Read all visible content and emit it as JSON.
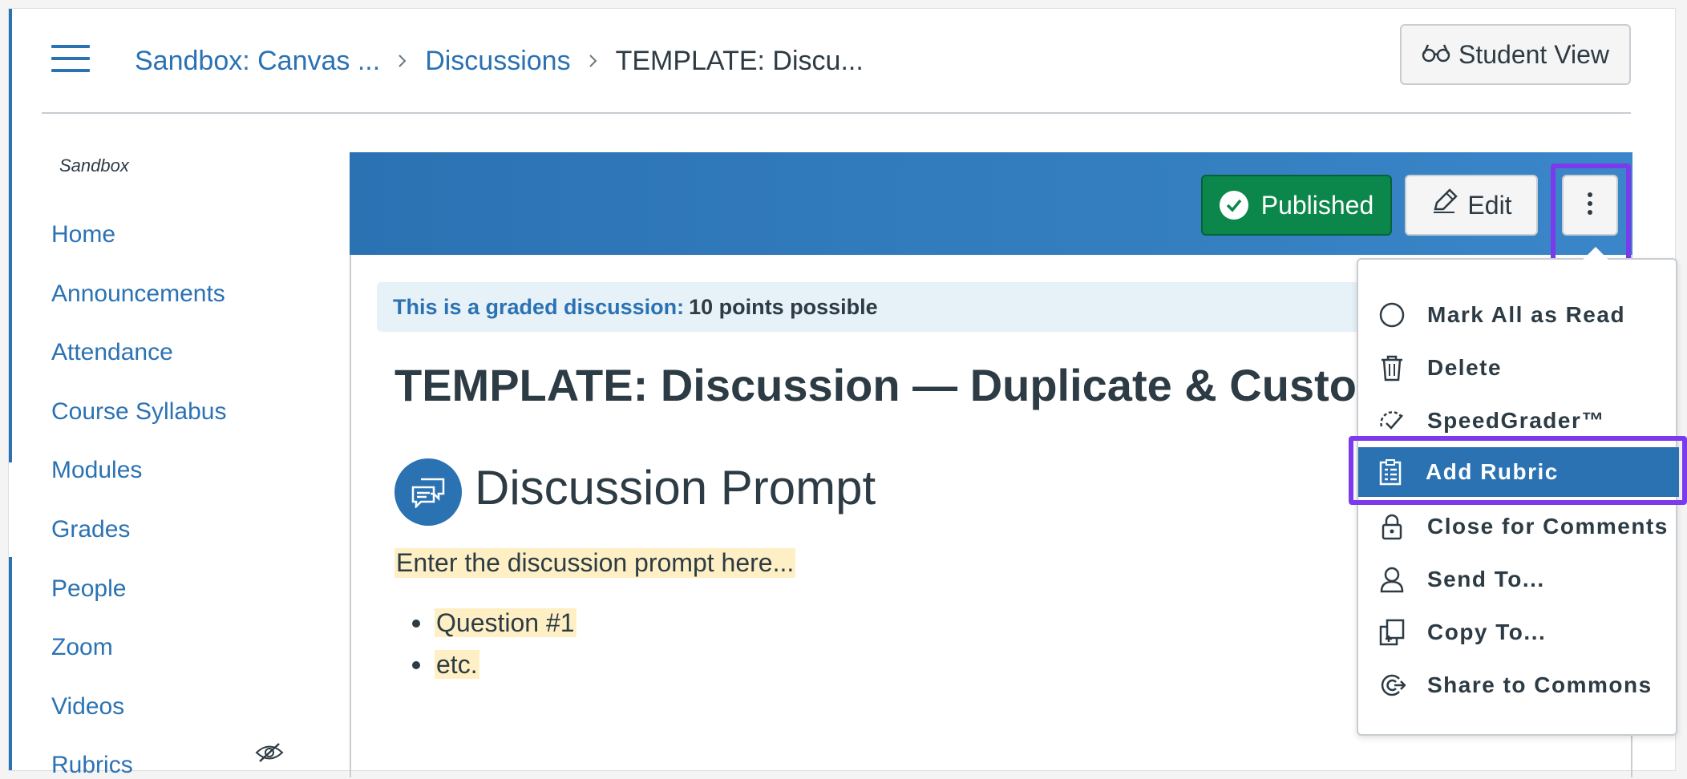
{
  "header": {
    "breadcrumb": {
      "course": "Sandbox: Canvas ...",
      "section": "Discussions",
      "current": "TEMPLATE: Discu..."
    },
    "student_view_label": "Student View"
  },
  "sidebar": {
    "course_label": "Sandbox",
    "items": [
      {
        "label": "Home"
      },
      {
        "label": "Announcements"
      },
      {
        "label": "Attendance"
      },
      {
        "label": "Course Syllabus"
      },
      {
        "label": "Modules"
      },
      {
        "label": "Grades"
      },
      {
        "label": "People"
      },
      {
        "label": "Zoom"
      },
      {
        "label": "Videos"
      },
      {
        "label": "Rubrics",
        "icon": "eye-slash-icon"
      }
    ]
  },
  "toolbar": {
    "published_label": "Published",
    "edit_label": "Edit"
  },
  "discussion": {
    "graded_label": "This is a graded discussion:",
    "points_text": "10 points possible",
    "title": "TEMPLATE: Discussion — Duplicate & Customize",
    "prompt_heading": "Discussion Prompt",
    "prompt_text": "Enter the discussion prompt here...",
    "bullets": [
      "Question #1",
      "etc."
    ]
  },
  "menu": {
    "items": [
      {
        "label": "Mark All as Read",
        "icon": "circle-icon"
      },
      {
        "label": "Delete",
        "icon": "trash-icon"
      },
      {
        "label": "SpeedGrader™",
        "icon": "speedgrader-icon"
      },
      {
        "label": "Add Rubric",
        "icon": "rubric-icon",
        "active": true
      },
      {
        "label": "Close for Comments",
        "icon": "lock-icon"
      },
      {
        "label": "Send To...",
        "icon": "user-icon"
      },
      {
        "label": "Copy To...",
        "icon": "copy-icon"
      },
      {
        "label": "Share to Commons",
        "icon": "commons-icon"
      }
    ]
  },
  "colors": {
    "accent": "#2b72b3",
    "published": "#0b874b",
    "highlight": "#7c3aed",
    "prompt_bg": "#fef0c4",
    "banner_bg": "#e6f1f8"
  }
}
